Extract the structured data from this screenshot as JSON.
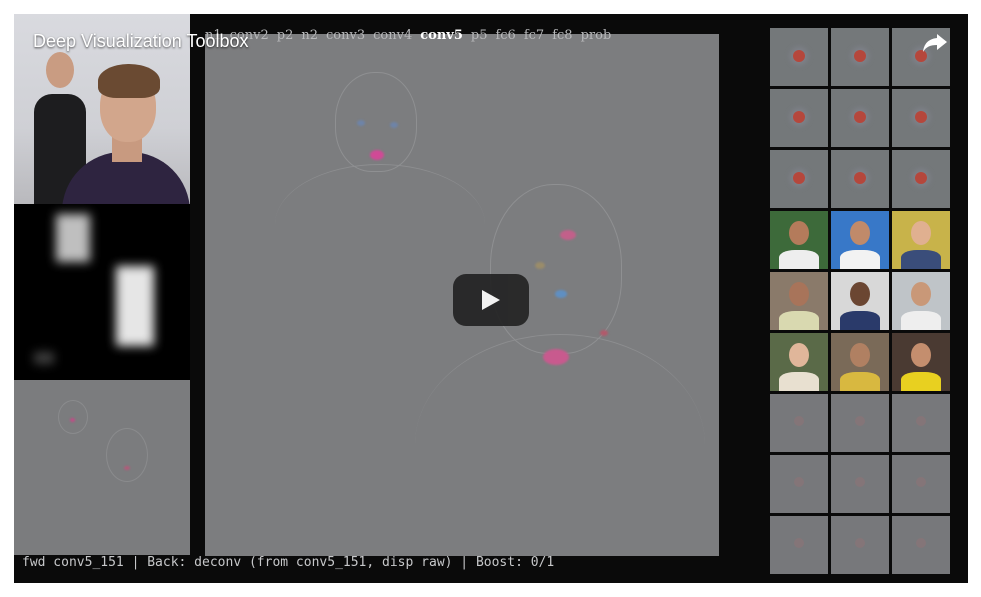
{
  "video": {
    "title": "Deep Visualization Toolbox",
    "share_icon": "share-arrow-icon",
    "play_icon": "play-icon"
  },
  "layers": {
    "items": [
      "n1",
      "conv2",
      "p2",
      "n2",
      "conv3",
      "conv4",
      "conv5",
      "p5",
      "fc6",
      "fc7",
      "fc8",
      "prob"
    ],
    "active": "conv5"
  },
  "status_line": "fwd conv5_151 | Back: deconv (from conv5_151, disp raw) | Boost: 0/1",
  "colors": {
    "player_bg": "#0a0a0a",
    "deconv_gray": "#7c7d7f",
    "highlight_pink": "#c9458f",
    "active_layer": "#ffffff"
  }
}
